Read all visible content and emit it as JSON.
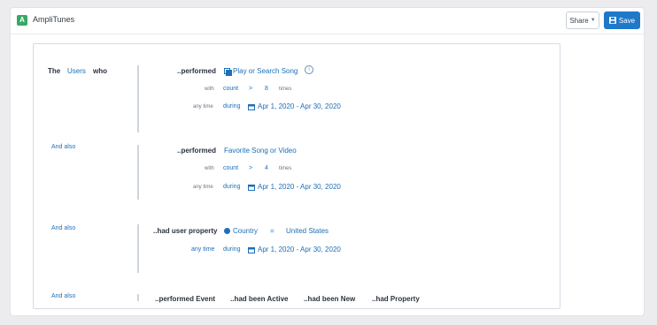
{
  "app": {
    "icon_letter": "A",
    "title": "AmpliTunes"
  },
  "toolbar": {
    "share_label": "Share",
    "save_label": "Save"
  },
  "colors": {
    "accent": "#1f78c8",
    "link": "#1d6fb8",
    "app_icon": "#37a864"
  },
  "cohort": {
    "prefix": "The",
    "subject": "Users",
    "who": "who",
    "conditions": [
      {
        "connector": "",
        "action": "..performed",
        "target": "Play or Search Song",
        "with": "with",
        "metric": "count",
        "operator": ">",
        "value": "8",
        "unit": "times",
        "time_label": "any time",
        "during": "during",
        "date_range": "Apr 1, 2020 - Apr 30, 2020"
      },
      {
        "connector": "And also",
        "action": "..performed",
        "target": "Favorite Song or Video",
        "with": "with",
        "metric": "count",
        "operator": ">",
        "value": "4",
        "unit": "times",
        "time_label": "any time",
        "during": "during",
        "date_range": "Apr 1, 2020 - Apr 30, 2020"
      },
      {
        "connector": "And also",
        "action": "..had user property",
        "property": "Country",
        "operator": "=",
        "value": "United States",
        "time_label": "any time",
        "during": "during",
        "date_range": "Apr 1, 2020 - Apr 30, 2020"
      }
    ],
    "add_connector": "And also",
    "add_options": [
      "..performed Event",
      "..had been Active",
      "..had been New",
      "..had Property"
    ]
  }
}
